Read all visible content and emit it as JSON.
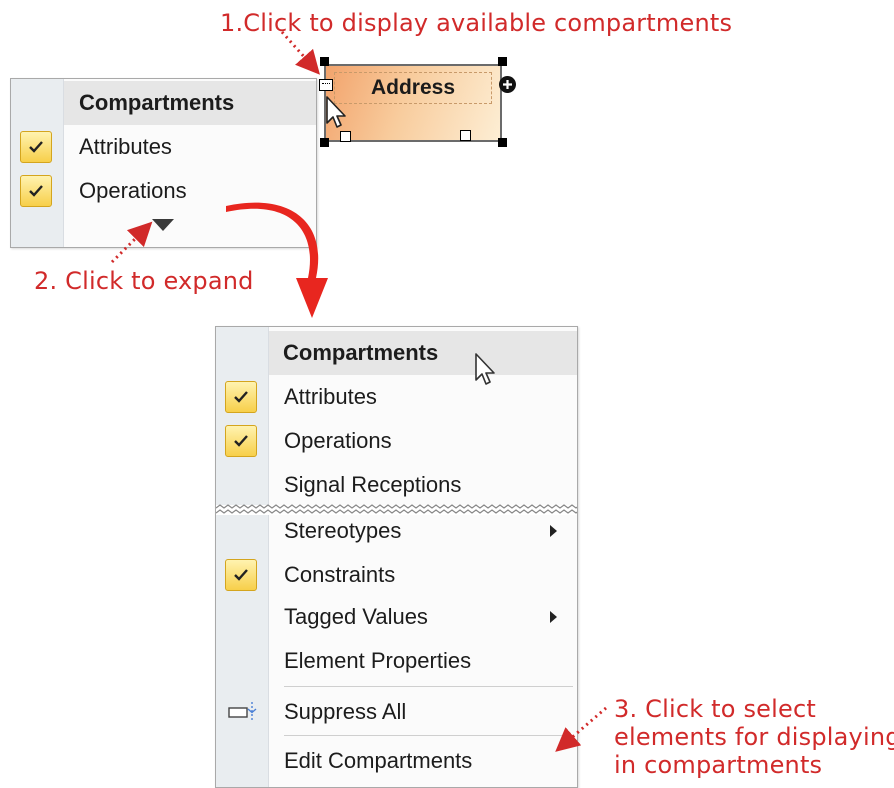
{
  "annotations": {
    "step1": "1.Click to display available compartments",
    "step2": "2. Click to expand",
    "step3_line1": "3. Click to select",
    "step3_line2": "elements for displaying",
    "step3_line3": "in compartments"
  },
  "node": {
    "title": "Address"
  },
  "small_menu": {
    "header": "Compartments",
    "items": [
      {
        "label": "Attributes",
        "checked": true
      },
      {
        "label": "Operations",
        "checked": true
      }
    ],
    "expand_icon": "triangle-down-icon"
  },
  "large_menu": {
    "header": "Compartments",
    "items_top": [
      {
        "label": "Attributes",
        "checked": true
      },
      {
        "label": "Operations",
        "checked": true
      },
      {
        "label": "Signal Receptions",
        "checked": false
      }
    ],
    "items_bottom": [
      {
        "label": "Stereotypes",
        "submenu": true
      },
      {
        "label": "Constraints",
        "checked": true
      },
      {
        "label": "Tagged Values",
        "submenu": true
      },
      {
        "label": "Element Properties"
      }
    ],
    "suppress_all": "Suppress All",
    "edit_compartments": "Edit Compartments"
  },
  "colors": {
    "annotation": "#d12a2a",
    "check_fill": "#f7cf4a",
    "node_fill": "#f8cc9d",
    "gutter": "#e9edf0"
  }
}
